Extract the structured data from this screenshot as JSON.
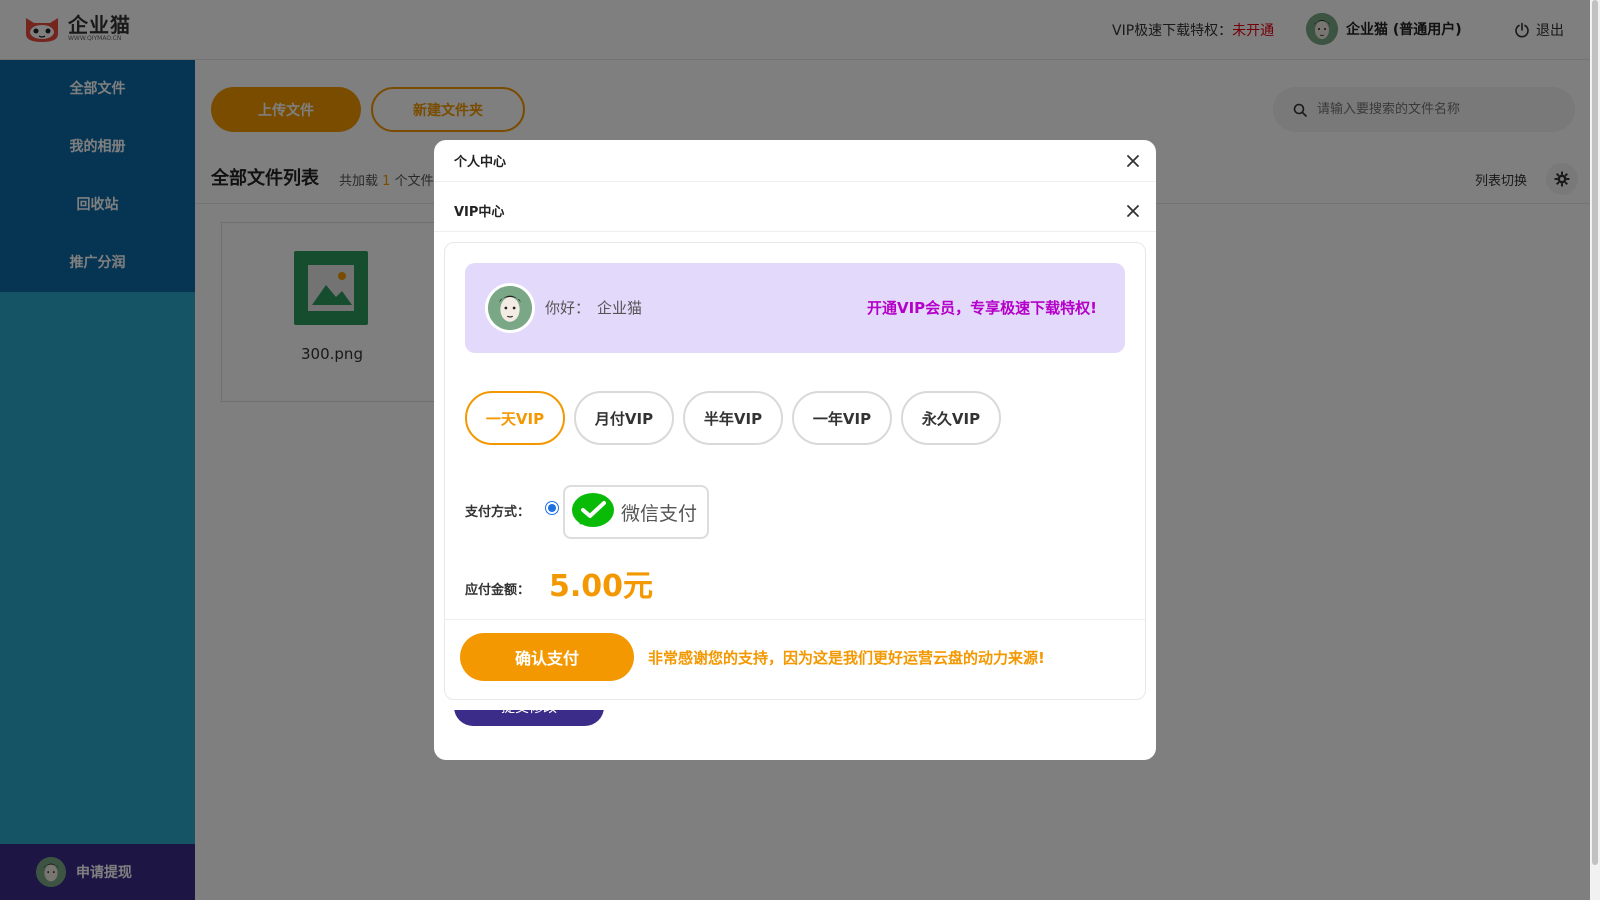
{
  "header": {
    "logo_text": "企业猫",
    "logo_sub": "WWW.QIYMAO.CN",
    "vip_status_label": "VIP极速下载特权：",
    "vip_status_value": "未开通",
    "user_name": "企业猫 (普通用户)",
    "logout_label": "退出"
  },
  "sidebar": {
    "items": [
      {
        "label": "全部文件"
      },
      {
        "label": "我的相册"
      },
      {
        "label": "回收站"
      },
      {
        "label": "推广分润"
      }
    ],
    "bottom_label": "申请提现"
  },
  "main": {
    "upload_label": "上传文件",
    "new_folder_label": "新建文件夹",
    "search_placeholder": "请输入要搜索的文件名称",
    "list_title": "全部文件列表",
    "count_prefix": "共加载",
    "count_value": "1",
    "count_suffix": "个文件",
    "list_switch_label": "列表切换",
    "files": [
      {
        "name": "300.png"
      }
    ]
  },
  "personal_dialog": {
    "title": "个人中心",
    "submit_label": "提交修改"
  },
  "vip_dialog": {
    "title": "VIP中心",
    "greet_label": "你好：",
    "greet_name": "企业猫",
    "promo": "开通VIP会员，专享极速下载特权!",
    "plans": [
      {
        "label": "一天VIP",
        "active": true
      },
      {
        "label": "月付VIP",
        "active": false
      },
      {
        "label": "半年VIP",
        "active": false
      },
      {
        "label": "一年VIP",
        "active": false
      },
      {
        "label": "永久VIP",
        "active": false
      }
    ],
    "pay_label": "支付方式：",
    "pay_method": "微信支付",
    "amount_label": "应付金额：",
    "amount_value": "5.00元",
    "confirm_label": "确认支付",
    "thanks": "非常感谢您的支持，因为这是我们更好运营云盘的动力来源!"
  },
  "colors": {
    "accent": "#f39800",
    "sidebar": "#2aa9c9",
    "sidebar_nav": "#0d6aa8",
    "purple": "#3b2c8a",
    "promo": "#b400c8",
    "banner": "#e3d9fb",
    "wechat": "#09bb07"
  }
}
